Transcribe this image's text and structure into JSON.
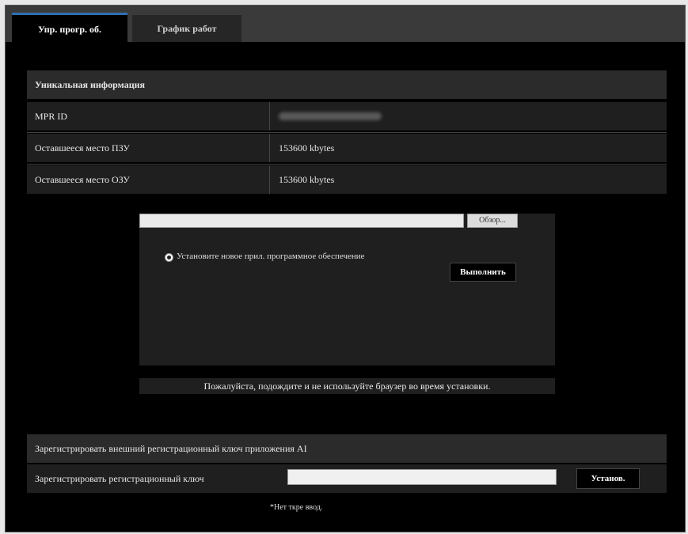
{
  "tabs": [
    {
      "label": "Упр. прогр. об.",
      "active": true
    },
    {
      "label": "График работ",
      "active": false
    }
  ],
  "info": {
    "header": "Уникальная информация",
    "rows": [
      {
        "label": "MPR ID",
        "value": ""
      },
      {
        "label": "Оставшееся место ПЗУ",
        "value": "153600 kbytes"
      },
      {
        "label": "Оставшееся место ОЗУ",
        "value": "153600 kbytes"
      }
    ]
  },
  "firmware": {
    "file_value": "",
    "browse_label": "Обзор...",
    "radio_label": "Установите новое прил. программное обеспечение",
    "execute_label": "Выполнить",
    "notice": "Пожалуйста, подождите и не используйте браузер во время установки."
  },
  "key": {
    "header": "Зарегистрировать внешний регистрационный ключ приложения AI",
    "label": "Зарегистрировать регистрационный ключ",
    "input_value": "",
    "button_label": "Установ.",
    "note": "*Нет ткре ввод."
  },
  "colors": {
    "background": "#000000",
    "row": "#1f1f1f",
    "header": "#2b2b2b",
    "tab_accent": "#2f6fb3"
  }
}
